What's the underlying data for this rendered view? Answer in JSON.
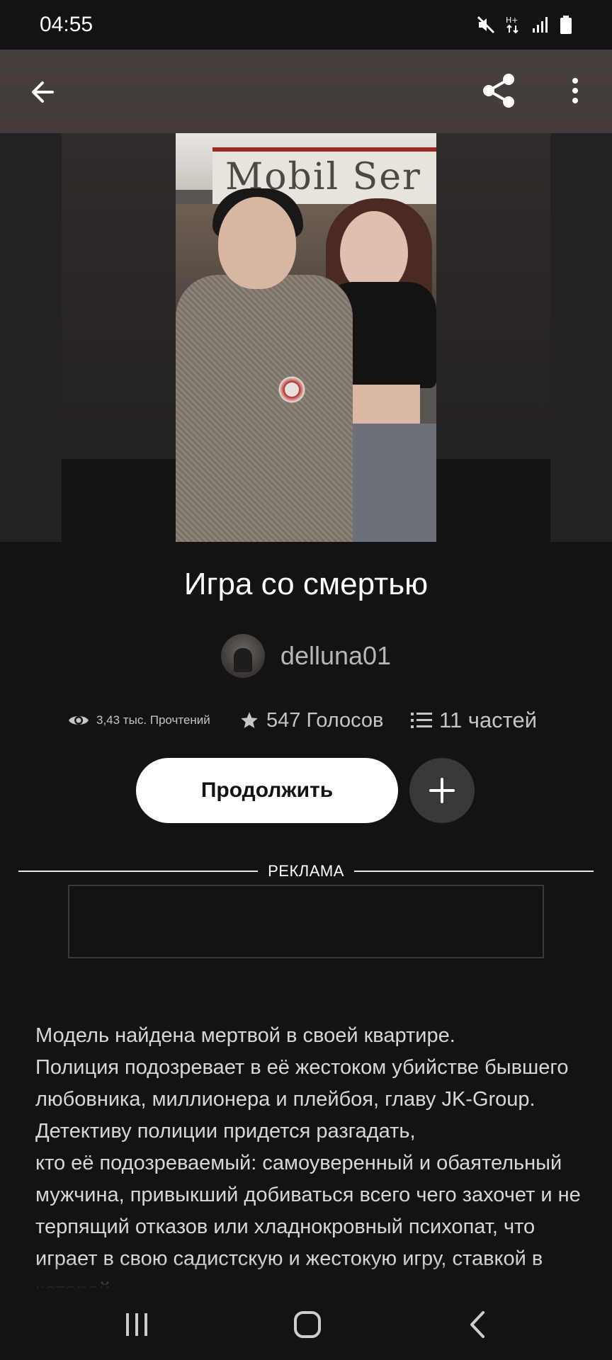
{
  "status_bar": {
    "time": "04:55",
    "icons": [
      "mute-icon",
      "data-transfer-icon",
      "signal-icon",
      "battery-icon"
    ]
  },
  "app_bar": {
    "back_icon": "arrow-left-icon",
    "share_icon": "share-icon",
    "more_icon": "more-vertical-icon"
  },
  "cover": {
    "sign_text": "Mobil Ser"
  },
  "story": {
    "title": "Игра со смертью",
    "author": "delluna01",
    "stats": {
      "reads": "3,43 тыс. Прочтений",
      "votes": "547 Голосов",
      "parts": "11 частей"
    }
  },
  "actions": {
    "continue_label": "Продолжить",
    "add_icon": "plus-icon"
  },
  "ad": {
    "label": "РЕКЛАМА"
  },
  "description": "Модель найдена мертвой в своей квартире.\nПолиция подозревает в её жестоком убийстве бывшего любовника, миллионера и плейбоя, главу JK-Group.\nДетективу  полиции придется разгадать,\nкто её подозреваемый: самоуверенный и обаятельный мужчина, привыкший добиваться всего чего захочет и не терпящий отказов или хладнокровный психопат, что играет в свою садистскую и жестокую игру, ставкой в которой",
  "nav_bar": {
    "recents_icon": "recents-icon",
    "home_icon": "home-icon",
    "back_icon": "back-chevron-icon"
  },
  "colors": {
    "background": "#141214",
    "primary_button": "#ffffff",
    "secondary_button": "#3a383b",
    "text_muted": "#b9b6b6"
  }
}
